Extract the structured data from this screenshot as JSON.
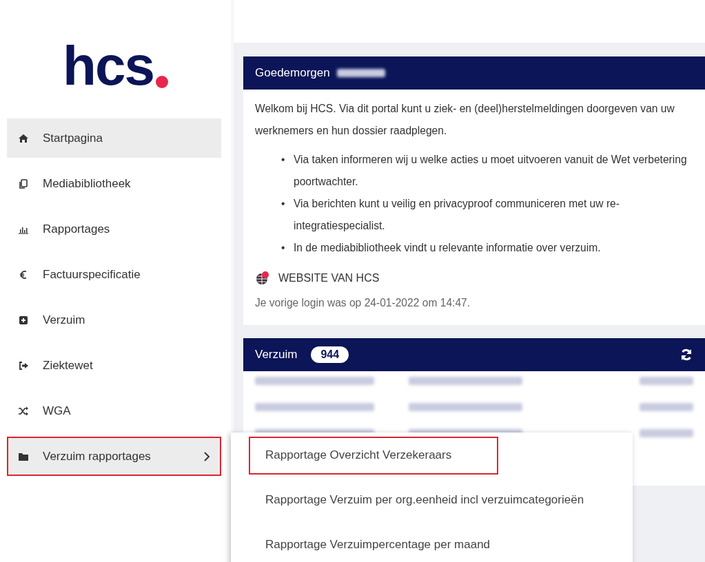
{
  "logo": {
    "text": "hcs"
  },
  "sidebar": {
    "items": [
      {
        "label": "Startpagina",
        "kind": "home",
        "selected": true,
        "highlighted": false,
        "has_submenu": false
      },
      {
        "label": "Mediabibliotheek",
        "kind": "copy",
        "selected": false,
        "highlighted": false,
        "has_submenu": false
      },
      {
        "label": "Rapportages",
        "kind": "chart",
        "selected": false,
        "highlighted": false,
        "has_submenu": false
      },
      {
        "label": "Factuurspecificatie",
        "kind": "euro",
        "selected": false,
        "highlighted": false,
        "has_submenu": false
      },
      {
        "label": "Verzuim",
        "kind": "plus",
        "selected": false,
        "highlighted": false,
        "has_submenu": false
      },
      {
        "label": "Ziektewet",
        "kind": "signout",
        "selected": false,
        "highlighted": false,
        "has_submenu": false
      },
      {
        "label": "WGA",
        "kind": "shuffle",
        "selected": false,
        "highlighted": false,
        "has_submenu": false
      },
      {
        "label": "Verzuim rapportages",
        "kind": "folder",
        "selected": true,
        "highlighted": true,
        "has_submenu": true
      }
    ]
  },
  "welcome_card": {
    "title": "Goedemorgen",
    "intro": "Welkom bij HCS. Via dit portal kunt u ziek- en (deel)herstelmeldingen doorgeven van uw werknemers en hun dossier raadplegen.",
    "bullet_marker": "•",
    "bullets": [
      "Via taken informeren wij u welke acties u moet uitvoeren vanuit de Wet verbetering poortwachter.",
      "Via berichten kunt u veilig en privacyproof communiceren met uw re-integratiespecialist.",
      "In de mediabibliotheek vindt u relevante informatie over verzuim."
    ],
    "website_link": "WEBSITE VAN HCS",
    "last_login": "Je vorige login was op 24-01-2022 om 14:47."
  },
  "verzuim_card": {
    "title": "Verzuim",
    "count": "944"
  },
  "submenu": {
    "items": [
      {
        "label": "Rapportage Overzicht Verzekeraars",
        "highlighted": true
      },
      {
        "label": "Rapportage Verzuim per org.eenheid incl verzuimcategorieën",
        "highlighted": false
      },
      {
        "label": "Rapportage Verzuimpercentage per maand",
        "highlighted": false
      }
    ]
  }
}
